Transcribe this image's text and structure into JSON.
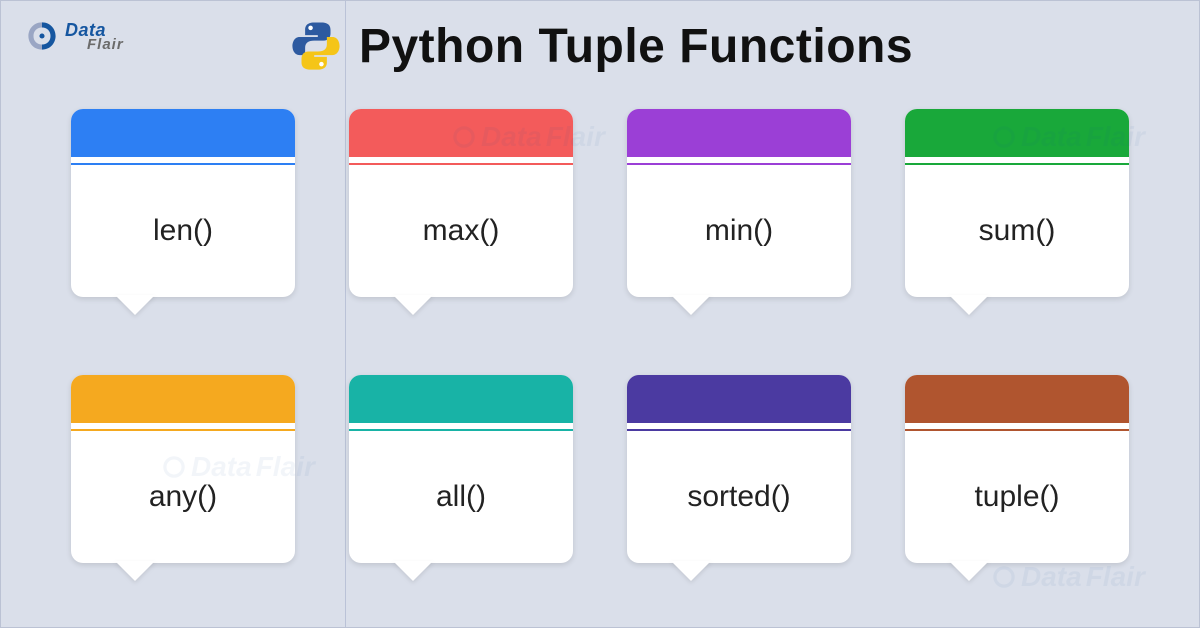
{
  "brand": {
    "top": "Data",
    "bottom": "Flair"
  },
  "title": "Python Tuple Functions",
  "cards": [
    {
      "label": "len()",
      "color": "#2d7ff3"
    },
    {
      "label": "max()",
      "color": "#f35b5b"
    },
    {
      "label": "min()",
      "color": "#9b3fd6"
    },
    {
      "label": "sum()",
      "color": "#19a83a"
    },
    {
      "label": "any()",
      "color": "#f5a91f"
    },
    {
      "label": "all()",
      "color": "#18b3a6"
    },
    {
      "label": "sorted()",
      "color": "#4b3aa1"
    },
    {
      "label": "tuple()",
      "color": "#b0552f"
    }
  ]
}
